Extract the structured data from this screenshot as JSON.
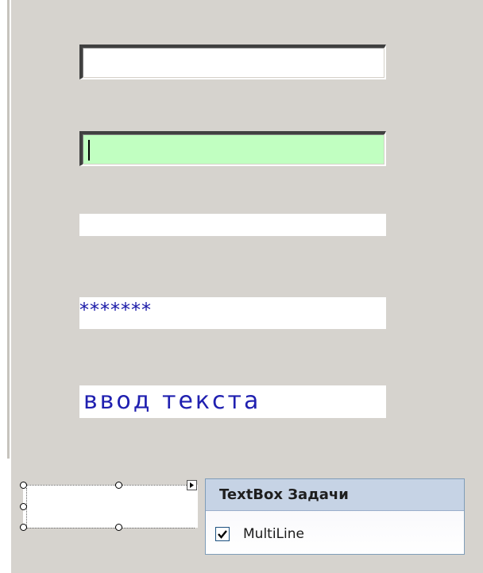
{
  "textboxes": [
    {
      "name": "textbox-1",
      "value": ""
    },
    {
      "name": "textbox-2",
      "value": "",
      "background": "#c1ffc1"
    },
    {
      "name": "textbox-3",
      "value": ""
    },
    {
      "name": "textbox-password",
      "value": "*******",
      "text_color": "#1a1aa8"
    },
    {
      "name": "textbox-text",
      "value": "ввод текста",
      "text_color": "#2020b0"
    }
  ],
  "tasks_panel": {
    "title": "TextBox Задачи",
    "multiline_label": "MultiLine",
    "multiline_checked": true
  },
  "colors": {
    "form_background": "#d6d3ce",
    "panel_header": "#c6d3e5",
    "panel_border": "#7f9db9"
  },
  "icons": {
    "smart_tag": "smart-tag-arrow-icon",
    "checkbox": "checkmark-icon"
  }
}
